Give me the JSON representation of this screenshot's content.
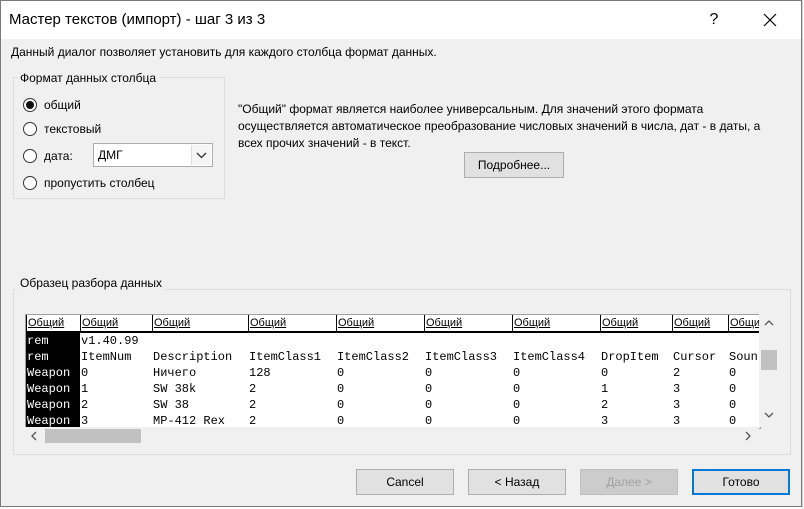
{
  "window": {
    "title": "Мастер текстов (импорт) - шаг 3 из 3",
    "help": "?",
    "description": "Данный диалог позволяет установить для каждого столбца формат данных."
  },
  "format_group": {
    "label": "Формат данных столбца",
    "options": [
      {
        "label": "общий",
        "checked": true
      },
      {
        "label": "текстовый",
        "checked": false
      },
      {
        "label": "дата:",
        "checked": false
      },
      {
        "label": "пропустить столбец",
        "checked": false
      }
    ],
    "date_format": "ДМГ"
  },
  "info": {
    "text": "\"Общий\" формат является наиболее универсальным. Для значений этого формата осуществляется автоматическое преобразование числовых значений в числа, дат - в даты, а всех прочих значений - в текст.",
    "more_button": "Подробнее..."
  },
  "preview": {
    "label": "Образец разбора данных",
    "columns": [
      {
        "header": "Общий",
        "cells": [
          "rem",
          "rem",
          "Weapon",
          "Weapon",
          "Weapon",
          "Weapon"
        ]
      },
      {
        "header": "Общий",
        "cells": [
          "v1.40.99",
          "ItemNum",
          "0",
          "1",
          "2",
          "3"
        ]
      },
      {
        "header": "Общий",
        "cells": [
          "",
          "Description",
          "Ничего",
          "SW 38k",
          "SW 38",
          "MP-412 Rex"
        ]
      },
      {
        "header": "Общий",
        "cells": [
          "",
          "ItemClass1",
          "128",
          "2",
          "2",
          "2"
        ]
      },
      {
        "header": "Общий",
        "cells": [
          "",
          "ItemClass2",
          "0",
          "0",
          "0",
          "0"
        ]
      },
      {
        "header": "Общий",
        "cells": [
          "",
          "ItemClass3",
          "0",
          "0",
          "0",
          "0"
        ]
      },
      {
        "header": "Общий",
        "cells": [
          "",
          "ItemClass4",
          "0",
          "0",
          "0",
          "0"
        ]
      },
      {
        "header": "Общий",
        "cells": [
          "",
          "DropItem",
          "0",
          "1",
          "2",
          "3"
        ]
      },
      {
        "header": "Общий",
        "cells": [
          "",
          "Cursor",
          "2",
          "3",
          "3",
          "3"
        ]
      },
      {
        "header": "Общий",
        "cells": [
          "",
          "Soun",
          "0",
          "0",
          "0",
          "0"
        ]
      }
    ]
  },
  "buttons": {
    "cancel": "Cancel",
    "back": "< Назад",
    "next": "Далее >",
    "finish": "Готово"
  }
}
